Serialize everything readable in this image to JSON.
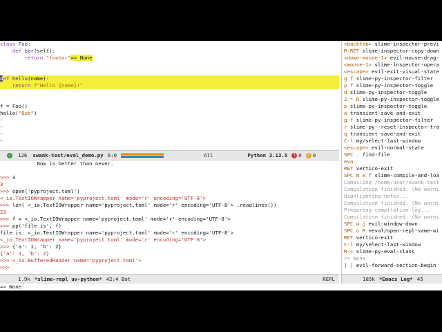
{
  "editor": {
    "lines": [
      [
        {
          "t": "class ",
          "c": "kw"
        },
        {
          "t": "Foo",
          "c": "fn"
        },
        {
          "t": ":",
          "c": ""
        }
      ],
      [
        {
          "t": "    ",
          "c": ""
        },
        {
          "t": "def ",
          "c": "kw"
        },
        {
          "t": "bar",
          "c": "fn"
        },
        {
          "t": "(self):",
          "c": ""
        }
      ],
      [
        {
          "t": "        ",
          "c": ""
        },
        {
          "t": "return ",
          "c": "kw"
        },
        {
          "t": "\"foobar\"",
          "c": "str"
        },
        {
          "t": "=> None",
          "c": "hlw"
        }
      ],
      [],
      [],
      [
        {
          "t": "d",
          "c": "cursor"
        },
        {
          "t": "ef ",
          "c": "kw"
        },
        {
          "t": "hello",
          "c": "fn"
        },
        {
          "t": "(name):",
          "c": ""
        }
      ],
      [
        {
          "t": "    ",
          "c": ""
        },
        {
          "t": "return ",
          "c": "kw"
        },
        {
          "t": "f\"Hello {name}!\"",
          "c": "str"
        }
      ],
      [],
      [],
      [
        {
          "t": "f = Foo()",
          "c": ""
        }
      ],
      [
        {
          "t": "hello(",
          "c": ""
        },
        {
          "t": "\"Bob\"",
          "c": "str"
        },
        {
          "t": ")",
          "c": ""
        }
      ],
      [
        {
          "t": "~",
          "c": "tilde"
        }
      ],
      [
        {
          "t": "~",
          "c": "tilde"
        }
      ],
      [
        {
          "t": "~",
          "c": "tilde"
        }
      ],
      [
        {
          "t": "~",
          "c": "tilde"
        }
      ]
    ],
    "highlight_lines": [
      5,
      6
    ]
  },
  "editor_modeline": {
    "left_num": "126",
    "buffer": "swank-test/eval_demo.py",
    "pos": "6:0",
    "scope": "All",
    "lang": "Python 3.13.5",
    "errors": "0",
    "warnings": "0"
  },
  "repl": {
    "lines": [
      [
        {
          "t": "            Now is better than never.",
          "c": ""
        }
      ],
      [],
      [
        {
          "t": ">>> ",
          "c": "red"
        },
        {
          "t": "3",
          "c": ""
        }
      ],
      [
        {
          "t": "3",
          "c": "red"
        }
      ],
      [
        {
          "t": ">>> ",
          "c": "red"
        },
        {
          "t": "open('pyproject.toml')",
          "c": ""
        }
      ],
      [
        {
          "t": "<_io.TextIOWrapper name='pyproject.toml' mode='r' encoding='UTF-8'>",
          "c": "red"
        }
      ],
      [
        {
          "t": ">>> ",
          "c": "red"
        },
        {
          "t": "len( <_io.TextIOWrapper name='pyproject.toml' mode='r' encoding='UTF-8'> .readlines())",
          "c": ""
        }
      ],
      [
        {
          "t": "23",
          "c": "red"
        }
      ],
      [
        {
          "t": ">>> ",
          "c": "red"
        },
        {
          "t": "f = <_io.TextIOWrapper name='pyproject.toml' mode='r' encoding='UTF-8'>",
          "c": ""
        }
      ],
      [
        {
          "t": ">>> ",
          "c": "red"
        },
        {
          "t": "pp('file is', f)",
          "c": ""
        }
      ],
      [
        {
          "t": "file is: <_io.TextIOWrapper name='pyproject.toml' mode='r' encoding='UTF-8'>",
          "c": ""
        }
      ],
      [
        {
          "t": "<_io.TextIOWrapper name='pyproject.toml' mode='r' encoding='UTF-8'>",
          "c": "red"
        }
      ],
      [
        {
          "t": ">>> ",
          "c": "red"
        },
        {
          "t": "{'a': 1, 'b': 2}",
          "c": ""
        }
      ],
      [
        {
          "t": "{'a': 1, 'b': 2}",
          "c": "red"
        }
      ],
      [
        {
          "t": ">>> ",
          "c": "red"
        },
        {
          "t": "<_io.BufferedReader name='pyproject.toml'>",
          "c": "red"
        }
      ],
      [
        {
          "t": ">>>",
          "c": "red"
        }
      ]
    ]
  },
  "repl_modeline": {
    "size": "1.9k",
    "buffer": "*slime-repl uv-python*",
    "pos": "42:4 Bot",
    "mode": "REPL"
  },
  "side": {
    "lines": [
      [
        {
          "t": "<backtab>",
          "c": "sidekey"
        },
        {
          "t": " slime-inspector-previ",
          "c": "sidecmd"
        }
      ],
      [
        {
          "t": "M-RET",
          "c": "sidekey"
        },
        {
          "t": " slime-inspector-copy-down",
          "c": "sidecmd"
        }
      ],
      [
        {
          "t": "<down-mouse-1>",
          "c": "sidekey"
        },
        {
          "t": " evil-mouse-drag-",
          "c": "sidecmd"
        }
      ],
      [
        {
          "t": "<mouse-1>",
          "c": "sidekey"
        },
        {
          "t": " slime-inspector-opera",
          "c": "sidecmd"
        }
      ],
      [
        {
          "t": "<escape>",
          "c": "sidekey"
        },
        {
          "t": " evil-exit-visual-state",
          "c": "sidecmd"
        }
      ],
      [
        {
          "t": "g f",
          "c": "sidekey"
        },
        {
          "t": " slime-py-inspector-filter",
          "c": "sidecmd"
        }
      ],
      [
        {
          "t": "p f",
          "c": "sidekey"
        },
        {
          "t": " slime-py-inspector-toggle",
          "c": "sidecmd"
        }
      ],
      [
        {
          "t": "d",
          "c": "sidekey"
        },
        {
          "t": " slime-py-inspector-toggle",
          "c": "sidecmd"
        }
      ],
      [
        {
          "t": "2 * D",
          "c": "sidekey"
        },
        {
          "t": " slime-py-inspector-toggle",
          "c": "sidecmd"
        }
      ],
      [
        {
          "t": "p",
          "c": "sidekey"
        },
        {
          "t": " slime-py-inspector-toggle",
          "c": "sidecmd"
        }
      ],
      [
        {
          "t": "a",
          "c": "sidekey"
        },
        {
          "t": " transient-save-and-exit",
          "c": "sidecmd"
        }
      ],
      [
        {
          "t": "g f",
          "c": "sidekey"
        },
        {
          "t": " slime-py-inspector-filter",
          "c": "sidecmd"
        }
      ],
      [
        {
          "t": "r",
          "c": "sidekey"
        },
        {
          "t": " slime-py--reset-inspector-tra",
          "c": "sidecmd"
        }
      ],
      [
        {
          "t": "q",
          "c": "sidekey"
        },
        {
          "t": " transient-save-and-exit",
          "c": "sidecmd"
        }
      ],
      [
        {
          "t": "C-l",
          "c": "sidekey"
        },
        {
          "t": " my/select-last-window",
          "c": "sidecmd"
        }
      ],
      [
        {
          "t": "<escape>",
          "c": "sidekey"
        },
        {
          "t": " evil-normal-state",
          "c": "sidecmd"
        }
      ],
      [
        {
          "t": "SPC . ",
          "c": "sidekey"
        },
        {
          "t": "find-file",
          "c": "sidecmd"
        }
      ],
      [
        {
          "t": "eva",
          "c": "sidekey"
        }
      ],
      [
        {
          "t": "RET",
          "c": "sidekey"
        },
        {
          "t": " vertico-exit",
          "c": "sidecmd"
        }
      ],
      [
        {
          "t": "SPC m e f",
          "c": "sidekey"
        },
        {
          "t": " slime-compile-and-loa",
          "c": "sidecmd"
        }
      ],
      [
        {
          "t": "Compiling /home/user/swank-test",
          "c": "sidedim"
        }
      ],
      [
        {
          "t": "Compilation finished. (No warni",
          "c": "sidedim"
        }
      ],
      [
        {
          "t": "Highlighting notes...",
          "c": "sidedim"
        }
      ],
      [
        {
          "t": "Compilation finished. (No warni",
          "c": "sidedim"
        }
      ],
      [
        {
          "t": "Preparing compilation log...",
          "c": "sidedim"
        }
      ],
      [
        {
          "t": "Compilation finished. (No warni",
          "c": "sidedim"
        }
      ],
      [
        {
          "t": "SPC w j",
          "c": "sidekey"
        },
        {
          "t": " evil-window-down",
          "c": "sidecmd"
        }
      ],
      [
        {
          "t": "SPC o R",
          "c": "sidekey"
        },
        {
          "t": " +eval/open-repl-same-wi",
          "c": "sidecmd"
        }
      ],
      [
        {
          "t": "RET",
          "c": "sidekey"
        },
        {
          "t": " vertico-exit",
          "c": "sidecmd"
        }
      ],
      [
        {
          "t": "C-l",
          "c": "sidekey"
        },
        {
          "t": " my/select-last-window",
          "c": "sidecmd"
        }
      ],
      [
        {
          "t": "M-c",
          "c": "sidekey"
        },
        {
          "t": " slime-py-eval-class",
          "c": "sidecmd"
        }
      ],
      [
        {
          "t": "=> None",
          "c": "sidedim"
        }
      ],
      [
        {
          "t": "] ]",
          "c": "sidekey"
        },
        {
          "t": " evil-forward-section-begin",
          "c": "sidecmd"
        }
      ]
    ]
  },
  "side_modeline_top": {
    "label": ""
  },
  "side_modeline_bottom": {
    "size": "185k",
    "buffer": "*Emacs Log*",
    "pos": "45"
  },
  "minibuffer": {
    "text": "=> None"
  }
}
